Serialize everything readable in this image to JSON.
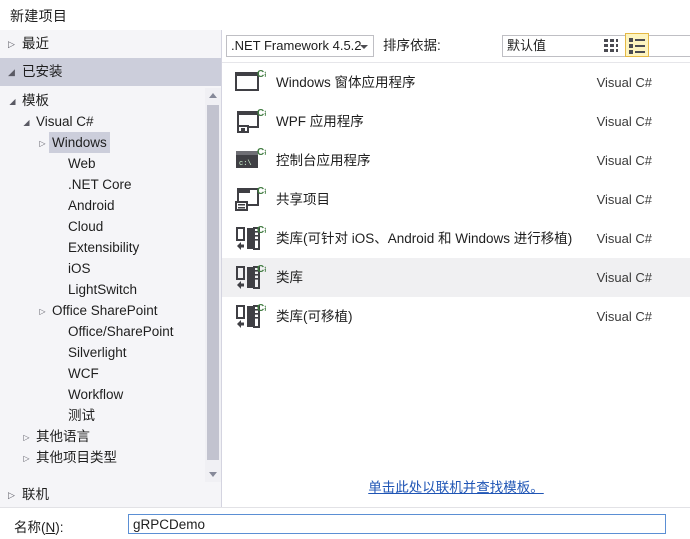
{
  "dialog": {
    "title": "新建项目"
  },
  "sidebar": {
    "recent": {
      "label": "最近",
      "arrow": "▷"
    },
    "installed": {
      "label": "已安装",
      "arrow": "◢"
    },
    "online": {
      "label": "联机",
      "arrow": "▷"
    },
    "tree": [
      {
        "label": "模板",
        "depth": 0,
        "arrow": "◢",
        "selected": false
      },
      {
        "label": "Visual C#",
        "depth": 1,
        "arrow": "◢",
        "selected": false
      },
      {
        "label": "Windows",
        "depth": 2,
        "arrow": "▷",
        "selected": true
      },
      {
        "label": "Web",
        "depth": 3,
        "arrow": "",
        "selected": false
      },
      {
        "label": ".NET Core",
        "depth": 3,
        "arrow": "",
        "selected": false
      },
      {
        "label": "Android",
        "depth": 3,
        "arrow": "",
        "selected": false
      },
      {
        "label": "Cloud",
        "depth": 3,
        "arrow": "",
        "selected": false
      },
      {
        "label": "Extensibility",
        "depth": 3,
        "arrow": "",
        "selected": false
      },
      {
        "label": "iOS",
        "depth": 3,
        "arrow": "",
        "selected": false
      },
      {
        "label": "LightSwitch",
        "depth": 3,
        "arrow": "",
        "selected": false
      },
      {
        "label": "Office SharePoint",
        "depth": 2,
        "arrow": "▷",
        "selected": false
      },
      {
        "label": "Office/SharePoint",
        "depth": 3,
        "arrow": "",
        "selected": false
      },
      {
        "label": "Silverlight",
        "depth": 3,
        "arrow": "",
        "selected": false
      },
      {
        "label": "WCF",
        "depth": 3,
        "arrow": "",
        "selected": false
      },
      {
        "label": "Workflow",
        "depth": 3,
        "arrow": "",
        "selected": false
      },
      {
        "label": "测试",
        "depth": 3,
        "arrow": "",
        "selected": false
      },
      {
        "label": "其他语言",
        "depth": 1,
        "arrow": "▷",
        "selected": false
      },
      {
        "label": "其他项目类型",
        "depth": 1,
        "arrow": "▷",
        "selected": false
      }
    ]
  },
  "toolbar": {
    "framework_value": ".NET Framework 4.5.2",
    "sort_label": "排序依据:",
    "sort_value": "默认值",
    "view_grid_icon": "grid-view-icon",
    "view_list_icon": "list-view-icon"
  },
  "templates": {
    "language_column": "Visual C#",
    "items": [
      {
        "name": "Windows 窗体应用程序",
        "language": "Visual C#",
        "icon": "winforms-icon",
        "selected": false
      },
      {
        "name": "WPF 应用程序",
        "language": "Visual C#",
        "icon": "wpf-icon",
        "selected": false
      },
      {
        "name": "控制台应用程序",
        "language": "Visual C#",
        "icon": "console-icon",
        "selected": false
      },
      {
        "name": "共享项目",
        "language": "Visual C#",
        "icon": "shared-project-icon",
        "selected": false
      },
      {
        "name": "类库(可针对 iOS、Android 和 Windows 进行移植)",
        "language": "Visual C#",
        "icon": "portable-class-library-icon",
        "selected": false
      },
      {
        "name": "类库",
        "language": "Visual C#",
        "icon": "class-library-icon",
        "selected": true
      },
      {
        "name": "类库(可移植)",
        "language": "Visual C#",
        "icon": "portable-class-library-icon",
        "selected": false
      }
    ]
  },
  "footer": {
    "online_templates_link": "单击此处以联机并查找模板。",
    "name_label_prefix": "名称(",
    "name_label_key": "N",
    "name_label_suffix": "):",
    "name_value": "gRPCDemo"
  },
  "colors": {
    "selection_blue_gray": "#cccedb",
    "row_selected": "#f0f0f2",
    "sidebar_bg": "#f5f5f8",
    "link": "#1f55b5",
    "csharp_green": "#3a8a3a",
    "active_button_border": "#e5b845",
    "active_button_fill": "#fdf4bf"
  }
}
